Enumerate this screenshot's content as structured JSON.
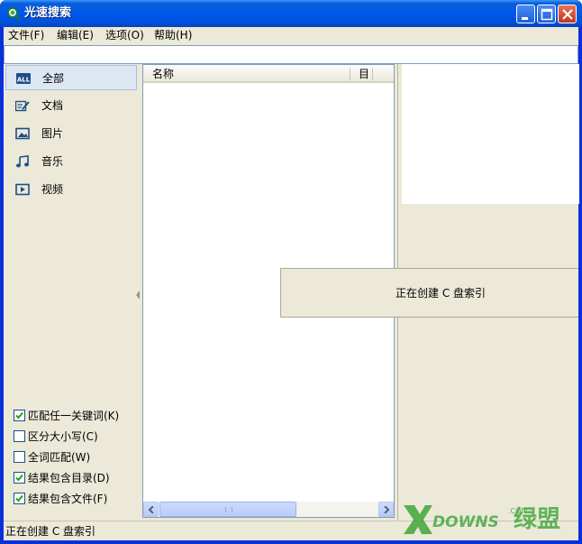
{
  "window": {
    "title": "光速搜索"
  },
  "menu": [
    "文件(F)",
    "编辑(E)",
    "选项(O)",
    "帮助(H)"
  ],
  "search": {
    "value": ""
  },
  "sidebar": {
    "items": [
      {
        "label": "全部",
        "icon": "all-icon",
        "selected": true
      },
      {
        "label": "文档",
        "icon": "document-icon",
        "selected": false
      },
      {
        "label": "图片",
        "icon": "picture-icon",
        "selected": false
      },
      {
        "label": "音乐",
        "icon": "music-icon",
        "selected": false
      },
      {
        "label": "视频",
        "icon": "video-icon",
        "selected": false
      }
    ],
    "options": [
      {
        "label": "匹配任一关键词(K)",
        "checked": true
      },
      {
        "label": "区分大小写(C)",
        "checked": false
      },
      {
        "label": "全词匹配(W)",
        "checked": false
      },
      {
        "label": "结果包含目录(D)",
        "checked": true
      },
      {
        "label": "结果包含文件(F)",
        "checked": true
      }
    ]
  },
  "list": {
    "columns": [
      "名称",
      "目"
    ]
  },
  "popup": {
    "text": "正在创建 C 盘索引"
  },
  "status": {
    "text": "正在创建 C 盘索引"
  },
  "watermark": {
    "text": "DOWNS",
    "suffix": "绿盟",
    "domain": ".COM"
  },
  "colors": {
    "titlebar": "#0058ee",
    "selection": "#dde6f3",
    "face": "#ece9d8"
  }
}
